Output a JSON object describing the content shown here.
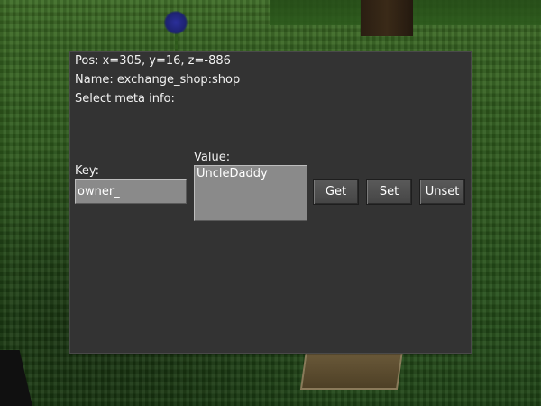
{
  "panel": {
    "pos_text": "Pos: x=305, y=16, z=-886",
    "name_text": "Name: exchange_shop:shop",
    "select_text": "Select meta info:"
  },
  "fields": {
    "key_label": "Key:",
    "key_value": "owner_",
    "value_label": "Value:",
    "value_value": "UncleDaddy"
  },
  "buttons": {
    "get": "Get",
    "set": "Set",
    "unset": "Unset"
  }
}
